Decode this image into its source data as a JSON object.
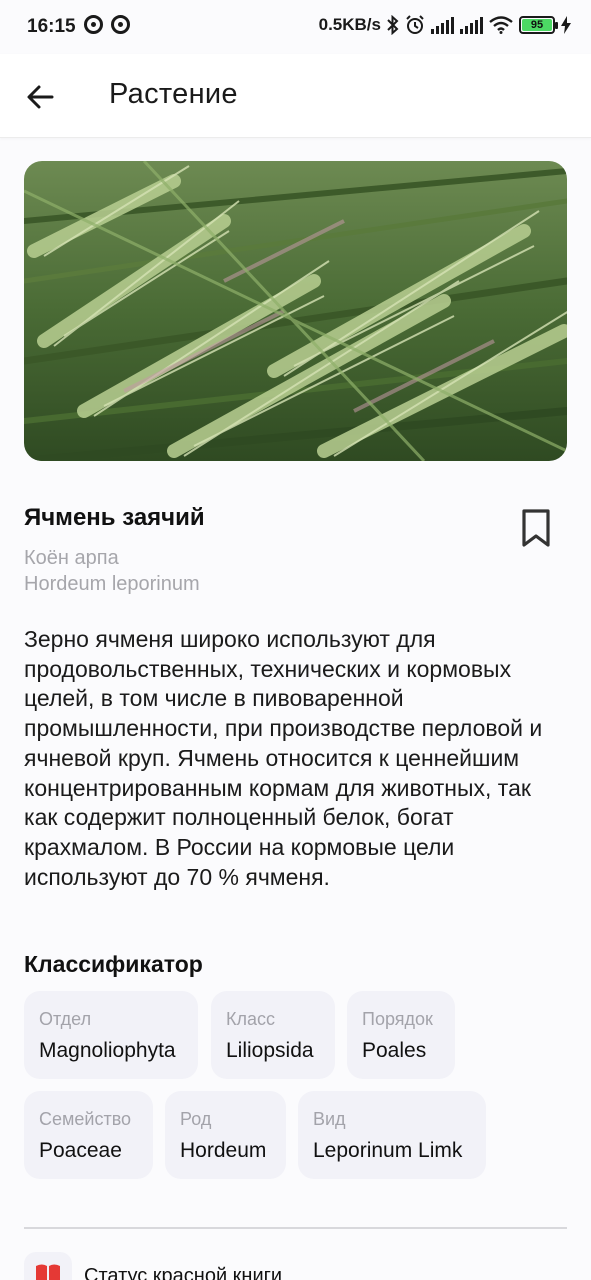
{
  "status_bar": {
    "time": "16:15",
    "network_speed": "0.5KB/s",
    "battery": "95",
    "icons": [
      "notification-ring-icon",
      "notification-ring-icon",
      "bluetooth-icon",
      "alarm-icon",
      "signal-icon",
      "signal-icon",
      "wifi-icon",
      "battery-icon",
      "charging-icon"
    ]
  },
  "app_bar": {
    "title": "Растение",
    "back_icon": "arrow-left-icon"
  },
  "plant": {
    "name": "Ячмень заячий",
    "kazakh_name": "Коён арпа",
    "latin_name": "Hordeum leporinum",
    "bookmark_icon": "bookmark-icon",
    "description": "Зерно ячменя широко используют для продовольственных, технических и кормовых целей, в том числе в пивоваренной промышленности, при производстве перловой и ячневой круп. Ячмень относится к ценнейшим концентрированным кормам для животных, так как содержит полноценный белок, богат крахмалом. В России на кормовые цели используют до 70 % ячменя."
  },
  "classifier": {
    "title": "Классификатор",
    "items": [
      {
        "label": "Отдел",
        "value": "Magnoliophyta"
      },
      {
        "label": "Класс",
        "value": "Liliopsida"
      },
      {
        "label": "Порядок",
        "value": "Poales"
      },
      {
        "label": "Семейство",
        "value": "Poaceae"
      },
      {
        "label": "Род",
        "value": "Hordeum"
      },
      {
        "label": "Вид",
        "value": "Leporinum Limk"
      }
    ]
  },
  "red_book": {
    "label": "Статус красной книги",
    "icon": "red-book-icon"
  },
  "colors": {
    "chip_background": "#f2f2f8",
    "secondary_text": "#a6a6ab",
    "red_book_accent": "#e53935"
  }
}
